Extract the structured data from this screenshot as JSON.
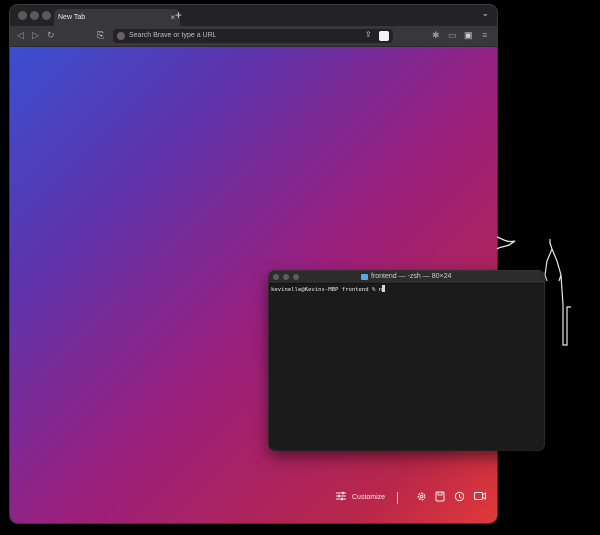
{
  "browser": {
    "tab": {
      "title": "New Tab",
      "close": "×"
    },
    "new_tab": "+",
    "tab_menu": "⌄",
    "nav": {
      "back": "◁",
      "forward": "▷",
      "reload": "↻",
      "bookmark": "⎘"
    },
    "address_bar": {
      "placeholder": "Search Brave or type a URL",
      "share": "⇪"
    },
    "extras": {
      "extensions": "✱",
      "sidebar": "▭",
      "wallet": "▣",
      "menu": "≡"
    }
  },
  "new_tab_page": {
    "customize_label": "Customize",
    "customize_icon": "sliders-icon",
    "icons": [
      "settings-icon",
      "bookmarks-icon",
      "history-icon",
      "video-icon"
    ]
  },
  "terminal": {
    "title": "frontend — -zsh — 80×24",
    "prompt": "kevinelle@Kevins-MBP frontend % ",
    "input": "n"
  }
}
